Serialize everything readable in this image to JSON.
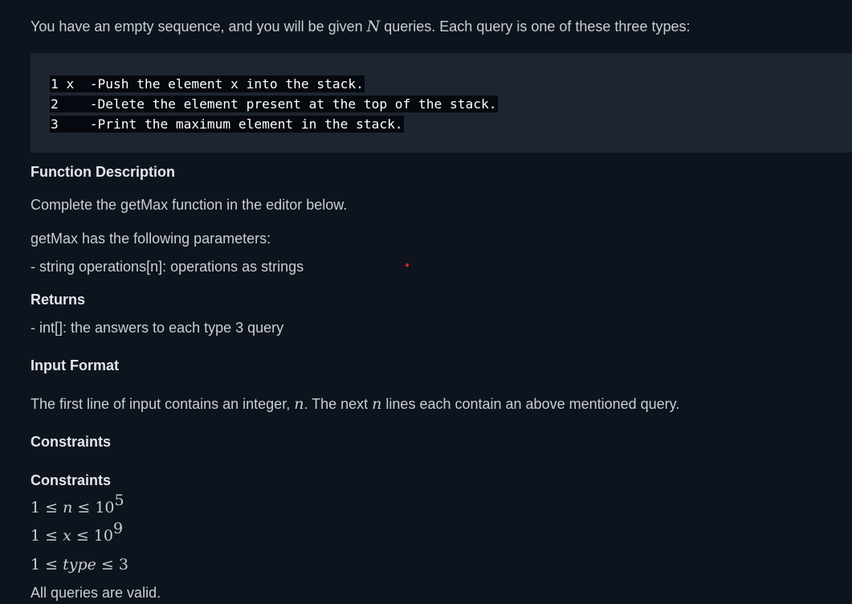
{
  "intro": {
    "before": "You have an empty sequence, and you will be given ",
    "var": "N",
    "after": " queries. Each query is one of these three types:"
  },
  "code": {
    "lines": [
      "1 x  -Push the element x into the stack.",
      "2    -Delete the element present at the top of the stack.",
      "3    -Print the maximum element in the stack."
    ]
  },
  "function_description": {
    "heading": "Function Description",
    "text": "Complete the getMax function in the editor below.",
    "params_intro": "getMax has the following parameters:",
    "param": "- string operations[n]: operations as strings"
  },
  "returns": {
    "heading": "Returns",
    "text": "- int[]: the answers to each type 3 query"
  },
  "input_format": {
    "heading": "Input Format",
    "part1": "The first line of input contains an integer, ",
    "var1": "n",
    "part2": ". The next ",
    "var2": "n",
    "part3": " lines each contain an above mentioned query."
  },
  "constraints": {
    "heading1": "Constraints",
    "heading2": "Constraints",
    "c1": {
      "lhs": "1 ≤ ",
      "var": "n",
      "rel": " ≤ 10",
      "exp": "5"
    },
    "c2": {
      "lhs": "1 ≤ ",
      "var": "x",
      "rel": " ≤ 10",
      "exp": "9"
    },
    "c3": {
      "lhs": "1 ≤ ",
      "var": "type",
      "rel": " ≤ 3"
    },
    "footer": "All queries are valid."
  },
  "colors": {
    "background": "#0e141e",
    "code_background": "#1d2530",
    "marker": "#e02525"
  }
}
